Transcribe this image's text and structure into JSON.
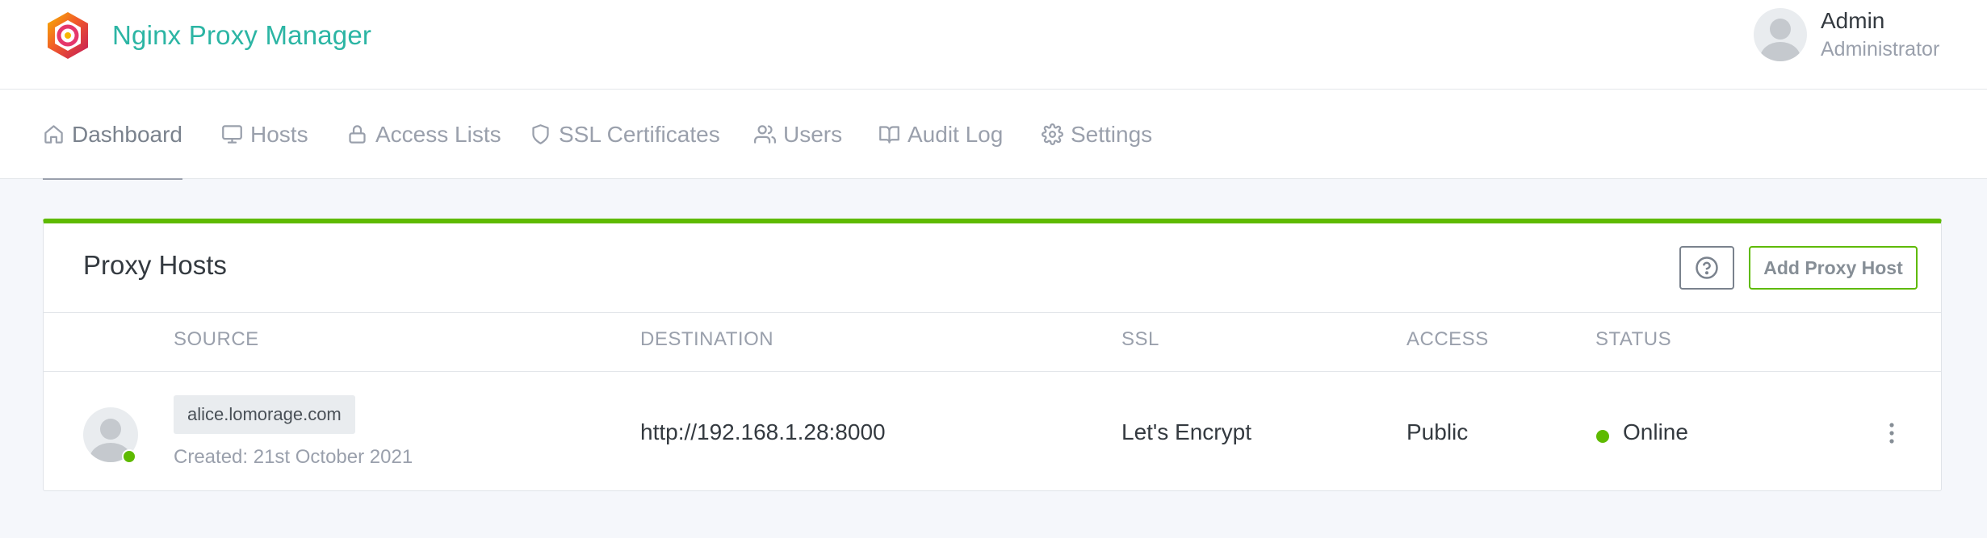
{
  "app": {
    "title": "Nginx Proxy Manager"
  },
  "user": {
    "name": "Admin",
    "role": "Administrator"
  },
  "nav": {
    "items": [
      {
        "label": "Dashboard",
        "icon": "home-icon",
        "active": true
      },
      {
        "label": "Hosts",
        "icon": "monitor-icon",
        "active": false
      },
      {
        "label": "Access Lists",
        "icon": "lock-icon",
        "active": false
      },
      {
        "label": "SSL Certificates",
        "icon": "shield-icon",
        "active": false
      },
      {
        "label": "Users",
        "icon": "users-icon",
        "active": false
      },
      {
        "label": "Audit Log",
        "icon": "book-open-icon",
        "active": false
      },
      {
        "label": "Settings",
        "icon": "gear-icon",
        "active": false
      }
    ]
  },
  "card": {
    "title": "Proxy Hosts",
    "add_button": "Add Proxy Host",
    "accent_color": "#5eba00",
    "columns": [
      "SOURCE",
      "DESTINATION",
      "SSL",
      "ACCESS",
      "STATUS"
    ],
    "rows": [
      {
        "domain": "alice.lomorage.com",
        "created": "Created: 21st October 2021",
        "destination": "http://192.168.1.28:8000",
        "ssl": "Let's Encrypt",
        "access": "Public",
        "status": "Online",
        "status_color": "#5eba00"
      }
    ]
  }
}
